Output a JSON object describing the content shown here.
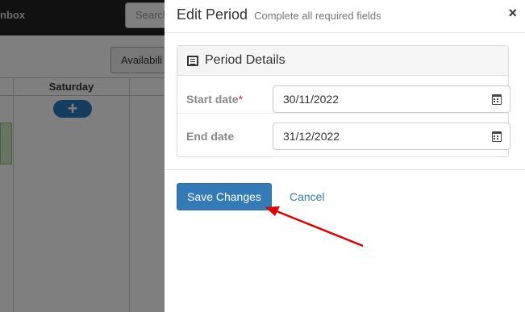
{
  "background": {
    "brand_text": "nbox",
    "search_placeholder": "Search",
    "availability_button": "Availabili",
    "day_header": "Saturday",
    "add_button": "+"
  },
  "modal": {
    "title": "Edit Period",
    "subtitle": "Complete all required fields",
    "close": "×",
    "panel": {
      "heading": "Period Details",
      "heading_icon": "list-alt-icon",
      "fields": [
        {
          "label": "Start date",
          "required_marker": "*",
          "value": "30/11/2022",
          "icon": "calendar-icon"
        },
        {
          "label": "End date",
          "value": "31/12/2022",
          "icon": "calendar-icon"
        }
      ]
    },
    "buttons": {
      "save": "Save Changes",
      "cancel": "Cancel"
    }
  },
  "colors": {
    "primary": "#337ab7",
    "annotation_arrow": "#e00000",
    "overlay": "rgba(0,0,0,0.5)"
  }
}
